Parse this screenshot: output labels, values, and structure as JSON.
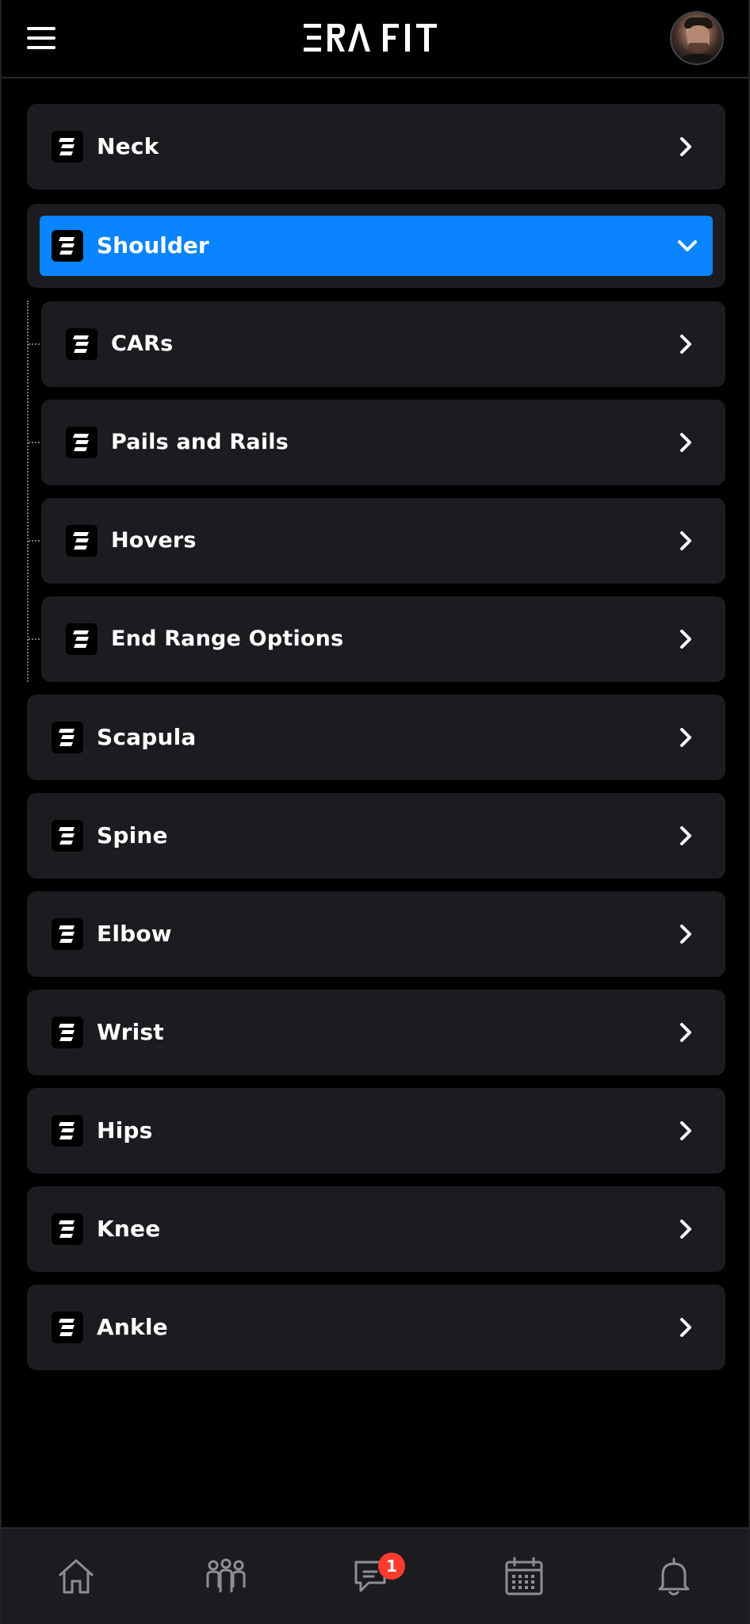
{
  "header": {
    "logo_text": "ERA FIT",
    "menu_icon": "hamburger-menu-icon",
    "avatar_icon": "user-avatar"
  },
  "categories": [
    {
      "label": "Neck",
      "expanded": false
    },
    {
      "label": "Shoulder",
      "expanded": true,
      "children": [
        {
          "label": "CARs"
        },
        {
          "label": "Pails and Rails"
        },
        {
          "label": "Hovers"
        },
        {
          "label": "End Range Options"
        }
      ]
    },
    {
      "label": "Scapula",
      "expanded": false
    },
    {
      "label": "Spine",
      "expanded": false
    },
    {
      "label": "Elbow",
      "expanded": false
    },
    {
      "label": "Wrist",
      "expanded": false
    },
    {
      "label": "Hips",
      "expanded": false
    },
    {
      "label": "Knee",
      "expanded": false
    },
    {
      "label": "Ankle",
      "expanded": false
    }
  ],
  "bottom_nav": {
    "items": [
      {
        "icon": "home-icon"
      },
      {
        "icon": "community-icon"
      },
      {
        "icon": "messages-icon",
        "badge": "1"
      },
      {
        "icon": "calendar-icon"
      },
      {
        "icon": "bell-icon"
      }
    ]
  },
  "colors": {
    "background": "#000000",
    "card": "#1c1b1f",
    "accent": "#0a84ff",
    "badge": "#ff3b30"
  }
}
